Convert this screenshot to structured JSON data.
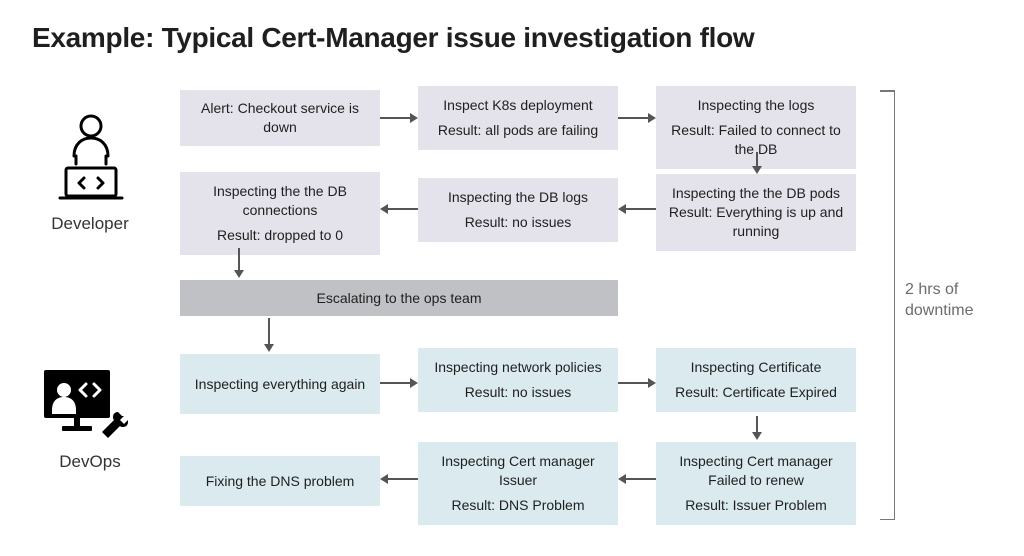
{
  "title": "Example: Typical Cert-Manager issue investigation flow",
  "roles": {
    "developer": "Developer",
    "devops": "DevOps"
  },
  "dev": {
    "b1_t": "Alert: Checkout service is down",
    "b2_t": "Inspect K8s deployment",
    "b2_r": "Result: all pods are failing",
    "b3_t": "Inspecting the logs",
    "b3_r": "Result: Failed to connect to the DB",
    "b4_t": "Inspecting the the DB pods",
    "b4_r": "Result: Everything is up and running",
    "b5_t": "Inspecting the DB logs",
    "b5_r": "Result: no issues",
    "b6_t": "Inspecting the the DB connections",
    "b6_r": "Result: dropped to 0"
  },
  "escalate": "Escalating to the ops team",
  "ops": {
    "b1_t": "Inspecting everything again",
    "b2_t": "Inspecting network policies",
    "b2_r": "Result: no issues",
    "b3_t": "Inspecting Certificate",
    "b3_r": "Result: Certificate Expired",
    "b4_t": "Inspecting Cert manager Failed to renew",
    "b4_r": "Result: Issuer Problem",
    "b5_t": "Inspecting Cert manager Issuer",
    "b5_r": "Result: DNS Problem",
    "b6_t": "Fixing the DNS problem"
  },
  "downtime": "2 hrs of downtime"
}
